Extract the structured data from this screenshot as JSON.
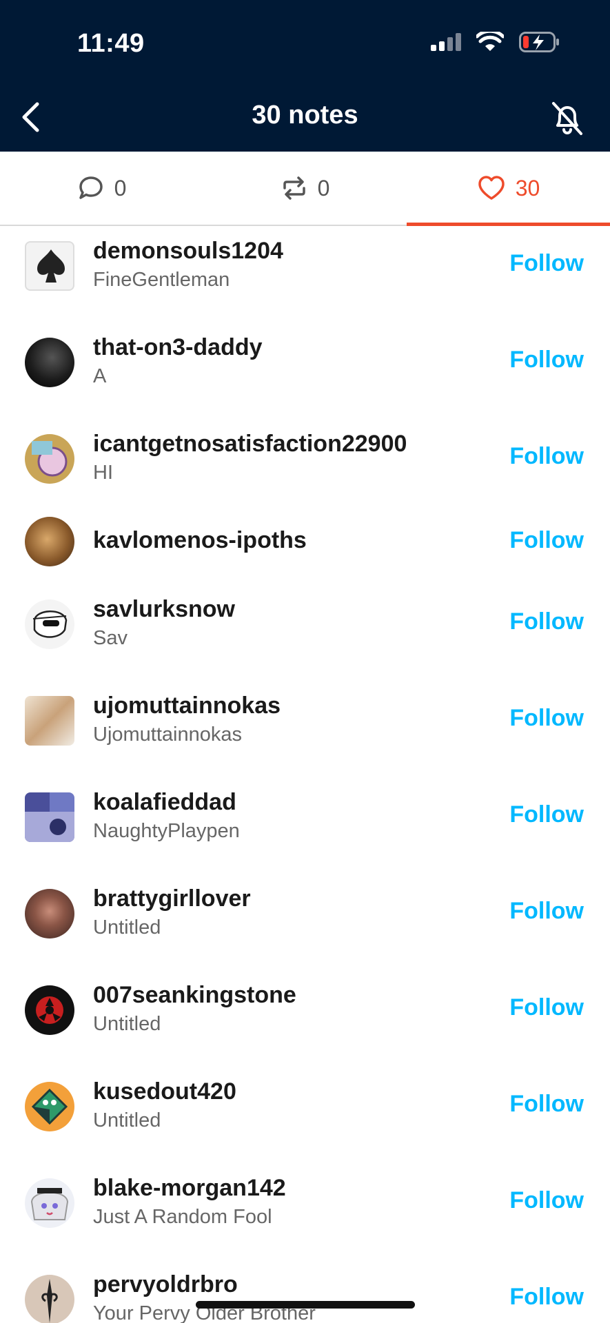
{
  "status_bar": {
    "time": "11:49"
  },
  "header": {
    "title": "30 notes"
  },
  "tabs": [
    {
      "icon": "comment-icon",
      "count": "0"
    },
    {
      "icon": "reblog-icon",
      "count": "0"
    },
    {
      "icon": "heart-icon",
      "count": "30"
    }
  ],
  "follow_label": "Follow",
  "users": [
    {
      "username": "demonsouls1204",
      "blog": "FineGentleman"
    },
    {
      "username": "that-on3-daddy",
      "blog": "A"
    },
    {
      "username": "icantgetnosatisfaction22900",
      "blog": "HI"
    },
    {
      "username": "kavlomenos-ipoths",
      "blog": ""
    },
    {
      "username": "savlurksnow",
      "blog": "Sav"
    },
    {
      "username": "ujomuttainnokas",
      "blog": "Ujomuttainnokas"
    },
    {
      "username": "koalafieddad",
      "blog": "NaughtyPlaypen"
    },
    {
      "username": "brattygirllover",
      "blog": "Untitled"
    },
    {
      "username": "007seankingstone",
      "blog": "Untitled"
    },
    {
      "username": "kusedout420",
      "blog": "Untitled"
    },
    {
      "username": "blake-morgan142",
      "blog": "Just A Random Fool"
    },
    {
      "username": "pervyoldrbro",
      "blog": "Your Pervy Older Brother"
    }
  ],
  "colors": {
    "header_bg": "#001935",
    "accent_red": "#ee4b2b",
    "follow_blue": "#00b8ff"
  }
}
